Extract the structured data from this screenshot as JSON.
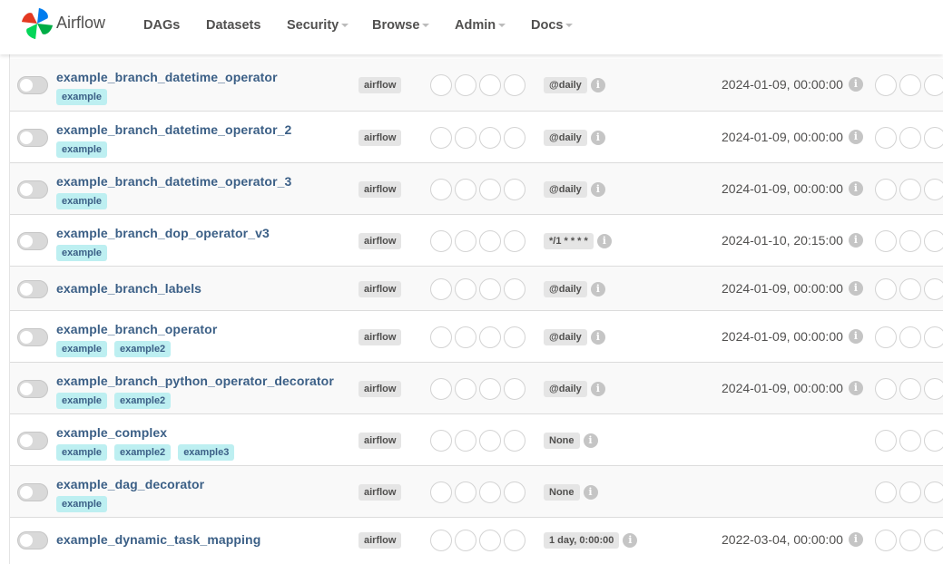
{
  "app": {
    "title": "Airflow"
  },
  "nav": {
    "items": [
      {
        "label": "DAGs",
        "dropdown": false
      },
      {
        "label": "Datasets",
        "dropdown": false
      },
      {
        "label": "Security",
        "dropdown": true
      },
      {
        "label": "Browse",
        "dropdown": true
      },
      {
        "label": "Admin",
        "dropdown": true
      },
      {
        "label": "Docs",
        "dropdown": true
      }
    ]
  },
  "colors": {
    "dag_link": "#3b5f86",
    "tag_bg": "#bdeff1",
    "badge_bg": "#e5e5e5",
    "toggle_off": "#d9d9d9"
  },
  "dags": [
    {
      "name": "example_branch_datetime_operator",
      "tags": [
        "example"
      ],
      "owner": "airflow",
      "schedule": "@daily",
      "next_run": "2024-01-09, 00:00:00"
    },
    {
      "name": "example_branch_datetime_operator_2",
      "tags": [
        "example"
      ],
      "owner": "airflow",
      "schedule": "@daily",
      "next_run": "2024-01-09, 00:00:00"
    },
    {
      "name": "example_branch_datetime_operator_3",
      "tags": [
        "example"
      ],
      "owner": "airflow",
      "schedule": "@daily",
      "next_run": "2024-01-09, 00:00:00"
    },
    {
      "name": "example_branch_dop_operator_v3",
      "tags": [
        "example"
      ],
      "owner": "airflow",
      "schedule": "*/1 * * * *",
      "next_run": "2024-01-10, 20:15:00"
    },
    {
      "name": "example_branch_labels",
      "tags": [],
      "owner": "airflow",
      "schedule": "@daily",
      "next_run": "2024-01-09, 00:00:00"
    },
    {
      "name": "example_branch_operator",
      "tags": [
        "example",
        "example2"
      ],
      "owner": "airflow",
      "schedule": "@daily",
      "next_run": "2024-01-09, 00:00:00"
    },
    {
      "name": "example_branch_python_operator_decorator",
      "tags": [
        "example",
        "example2"
      ],
      "owner": "airflow",
      "schedule": "@daily",
      "next_run": "2024-01-09, 00:00:00"
    },
    {
      "name": "example_complex",
      "tags": [
        "example",
        "example2",
        "example3"
      ],
      "owner": "airflow",
      "schedule": "None",
      "next_run": ""
    },
    {
      "name": "example_dag_decorator",
      "tags": [
        "example"
      ],
      "owner": "airflow",
      "schedule": "None",
      "next_run": ""
    },
    {
      "name": "example_dynamic_task_mapping",
      "tags": [],
      "owner": "airflow",
      "schedule": "1 day, 0:00:00",
      "next_run": "2022-03-04, 00:00:00"
    }
  ]
}
